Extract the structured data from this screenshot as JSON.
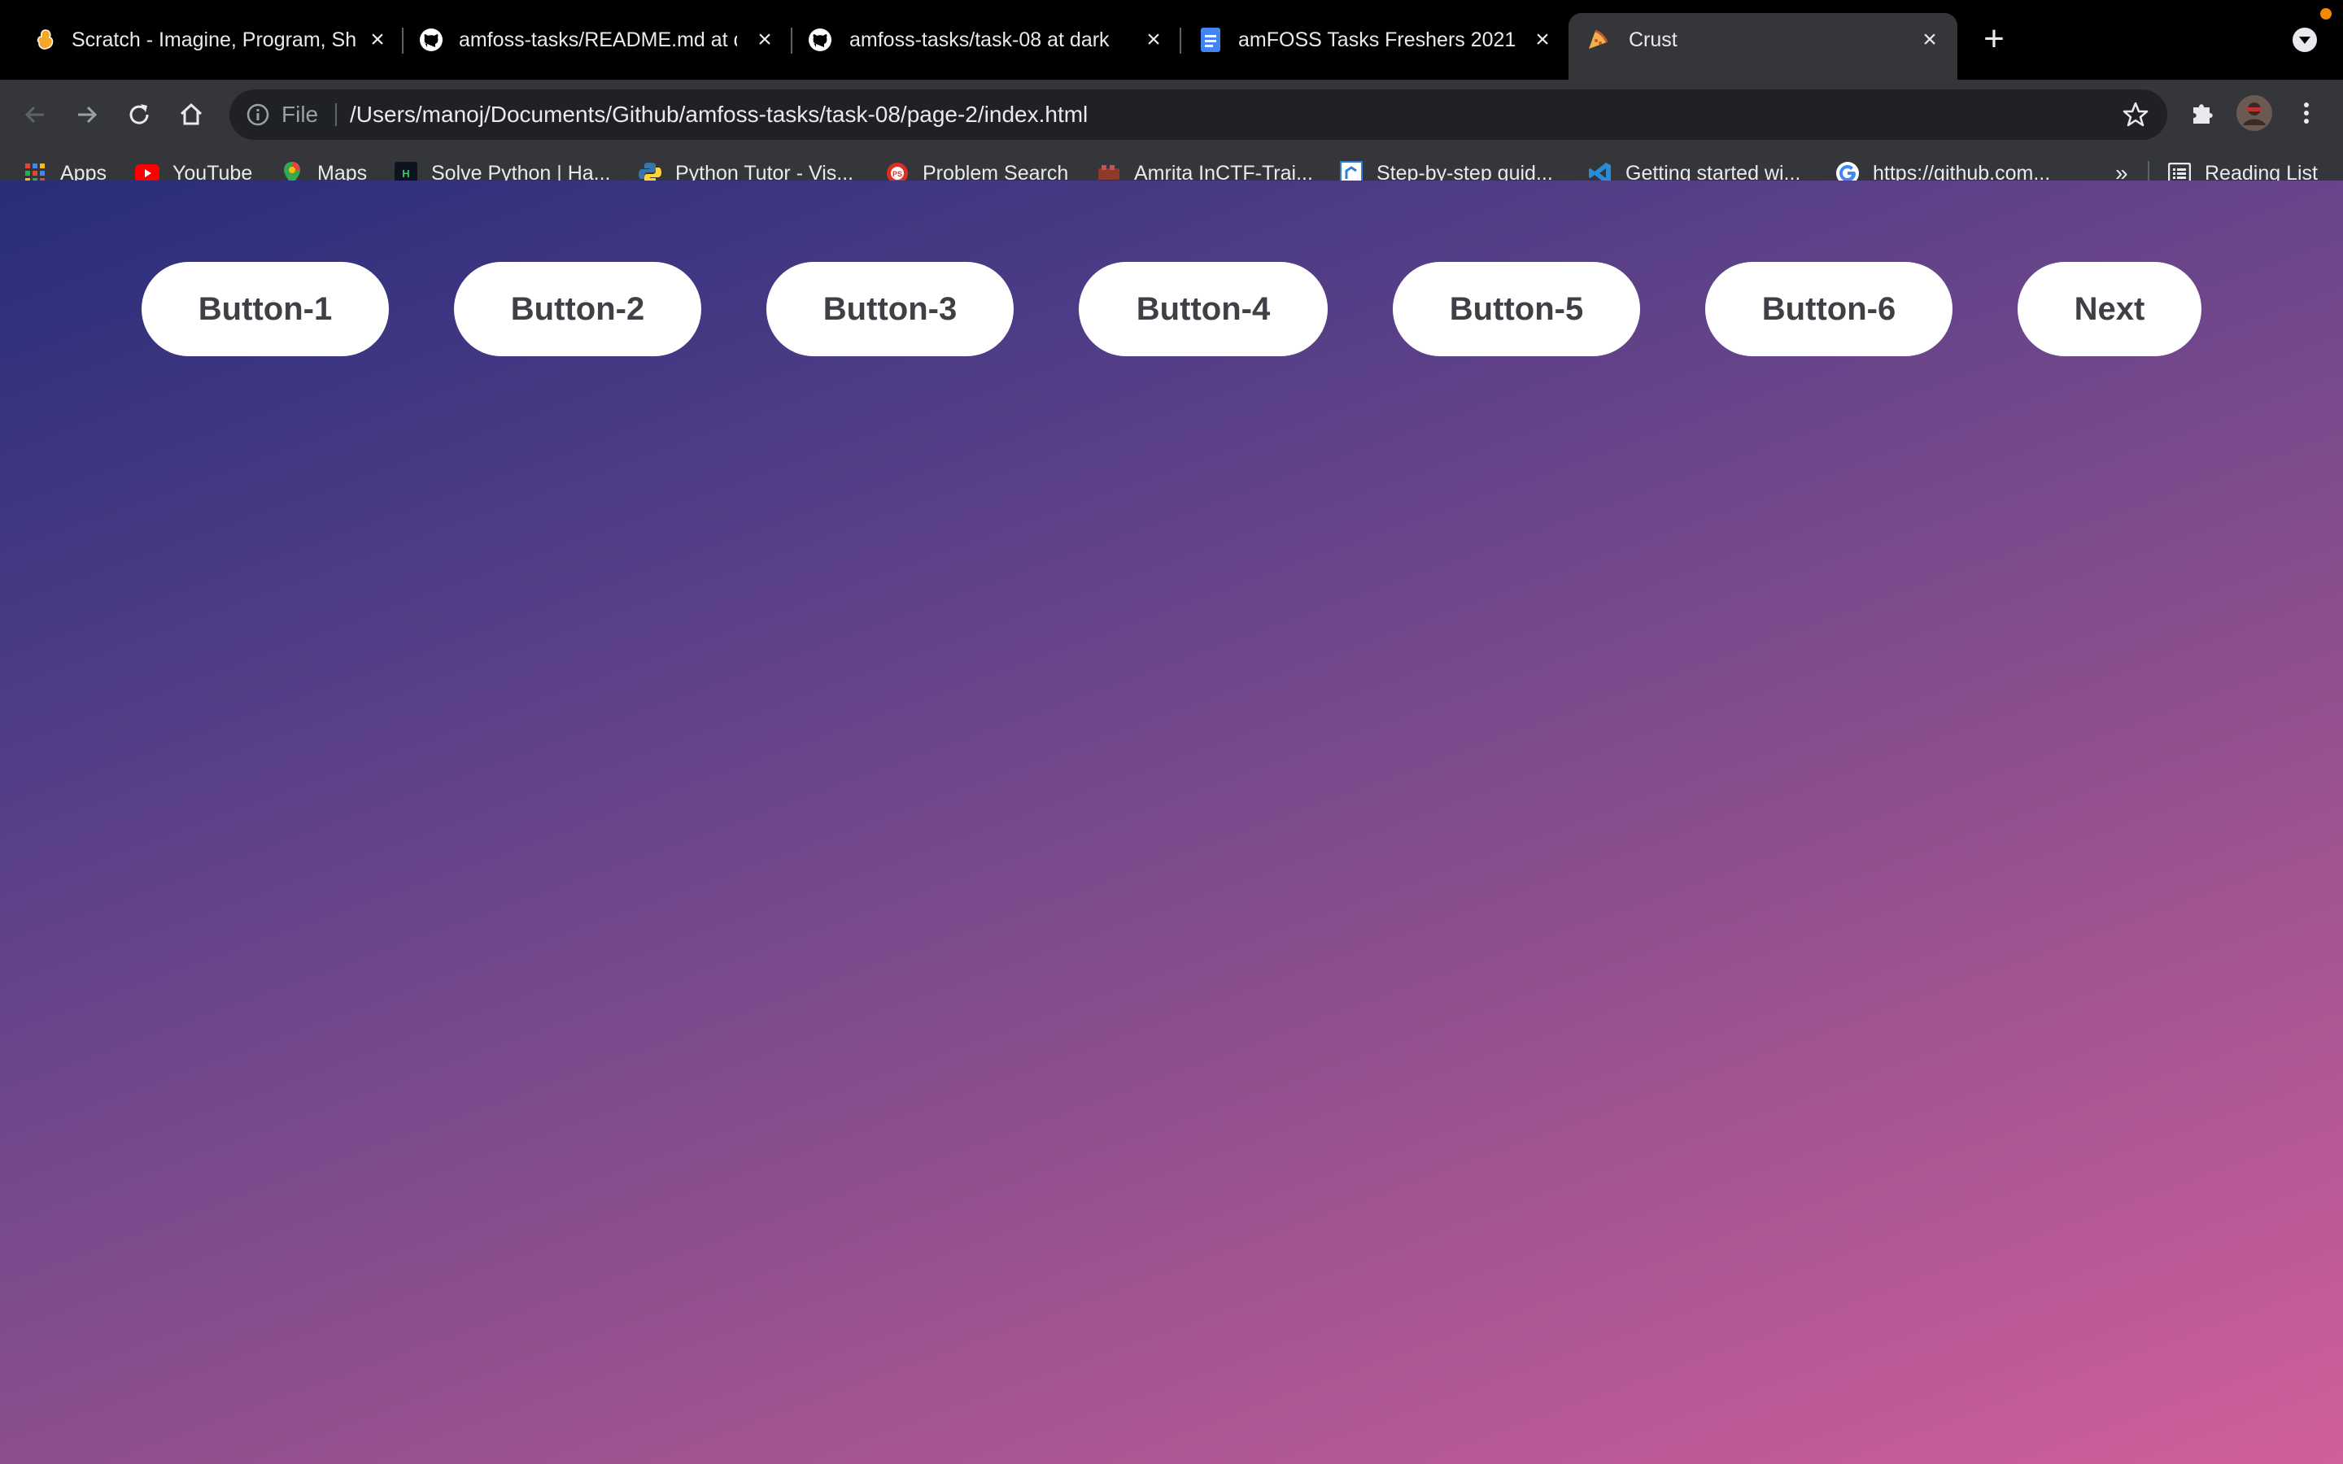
{
  "browser": {
    "tabs": [
      {
        "title": "Scratch - Imagine, Program, Sh",
        "icon": "scratch-icon",
        "active": false
      },
      {
        "title": "amfoss-tasks/README.md at d",
        "icon": "github-icon",
        "active": false
      },
      {
        "title": "amfoss-tasks/task-08 at dark",
        "icon": "github-icon",
        "active": false
      },
      {
        "title": "amFOSS Tasks Freshers 2021 -",
        "icon": "google-docs-icon",
        "active": false
      },
      {
        "title": "Crust",
        "icon": "pizza-icon",
        "active": true
      }
    ],
    "new_tab_label": "+",
    "address": {
      "scheme_label": "File",
      "url": "/Users/manoj/Documents/Github/amfoss-tasks/task-08/page-2/index.html"
    },
    "bookmarks": [
      {
        "label": "Apps",
        "icon": "apps-grid-icon"
      },
      {
        "label": "YouTube",
        "icon": "youtube-icon"
      },
      {
        "label": "Maps",
        "icon": "maps-pin-icon"
      },
      {
        "label": "Solve Python | Ha...",
        "icon": "hackerrank-icon"
      },
      {
        "label": "Python Tutor - Vis...",
        "icon": "python-icon"
      },
      {
        "label": "Problem Search",
        "icon": "problem-search-icon"
      },
      {
        "label": "Amrita InCTF-Trai...",
        "icon": "inctf-icon"
      },
      {
        "label": "Step-by-step guid...",
        "icon": "document-icon"
      },
      {
        "label": "Getting started wi...",
        "icon": "vscode-icon"
      },
      {
        "label": "https://github.com...",
        "icon": "google-icon"
      }
    ],
    "bookmarks_overflow": "»",
    "reading_list_label": "Reading List"
  },
  "page": {
    "buttons": [
      "Button-1",
      "Button-2",
      "Button-3",
      "Button-4",
      "Button-5",
      "Button-6"
    ],
    "next_label": "Next"
  },
  "colors": {
    "gradient_start": "#272d7a",
    "gradient_end": "#cf5f9a",
    "button_bg": "#ffffff",
    "button_text": "#3f3f46"
  }
}
